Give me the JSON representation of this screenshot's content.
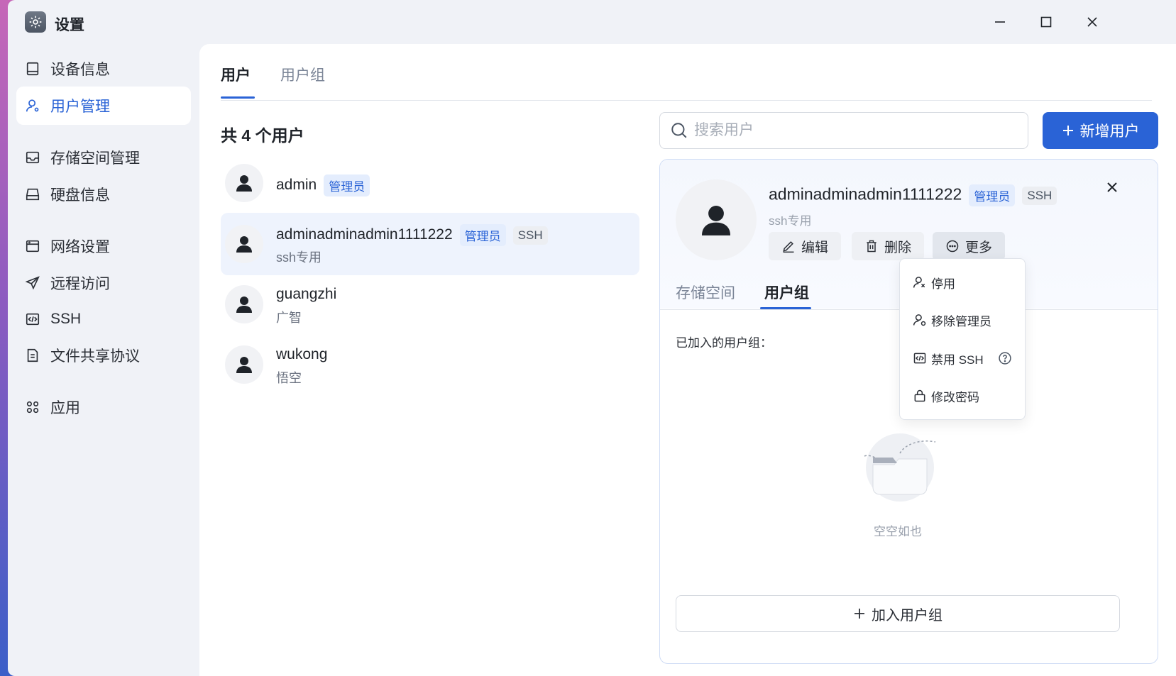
{
  "app": {
    "title": "设置"
  },
  "sidebar": {
    "items": [
      {
        "label": "设备信息",
        "icon": "device-icon"
      },
      {
        "label": "用户管理",
        "icon": "user-icon"
      },
      {
        "label": "存储空间管理",
        "icon": "storage-icon"
      },
      {
        "label": "硬盘信息",
        "icon": "disk-icon"
      },
      {
        "label": "网络设置",
        "icon": "network-icon"
      },
      {
        "label": "远程访问",
        "icon": "send-icon"
      },
      {
        "label": "SSH",
        "icon": "code-icon"
      },
      {
        "label": "文件共享协议",
        "icon": "file-icon"
      },
      {
        "label": "应用",
        "icon": "apps-icon"
      }
    ],
    "active": "用户管理"
  },
  "main": {
    "tabs": [
      {
        "label": "用户"
      },
      {
        "label": "用户组"
      }
    ],
    "count_title": "共 4 个用户",
    "search": {
      "placeholder": "搜索用户"
    },
    "add_button": "新增用户"
  },
  "users": [
    {
      "name": "admin",
      "sub": "",
      "admin_badge": "管理员",
      "ssh_badge": ""
    },
    {
      "name": "adminadminadmin1111222",
      "sub": "ssh专用",
      "admin_badge": "管理员",
      "ssh_badge": "SSH"
    },
    {
      "name": "guangzhi",
      "sub": "广智",
      "admin_badge": "",
      "ssh_badge": ""
    },
    {
      "name": "wukong",
      "sub": "悟空",
      "admin_badge": "",
      "ssh_badge": ""
    }
  ],
  "detail": {
    "name": "adminadminadmin1111222",
    "admin_badge": "管理员",
    "ssh_badge": "SSH",
    "sub": "ssh专用",
    "actions": {
      "edit": "编辑",
      "delete": "删除",
      "more": "更多"
    },
    "tabs": [
      {
        "label": "存储空间"
      },
      {
        "label": "用户组"
      }
    ],
    "joined_label": "已加入的用户组：",
    "empty_text": "空空如也",
    "join_button": "加入用户组"
  },
  "more_menu": {
    "items": [
      {
        "label": "停用",
        "icon": "user-disable-icon"
      },
      {
        "label": "移除管理员",
        "icon": "user-admin-icon"
      },
      {
        "label": "禁用 SSH",
        "icon": "code-icon"
      },
      {
        "label": "修改密码",
        "icon": "lock-icon"
      }
    ]
  },
  "colors": {
    "accent": "#2a63d6",
    "selected_row": "#eef3fd",
    "sidebar_bg": "#f0f2f7"
  }
}
